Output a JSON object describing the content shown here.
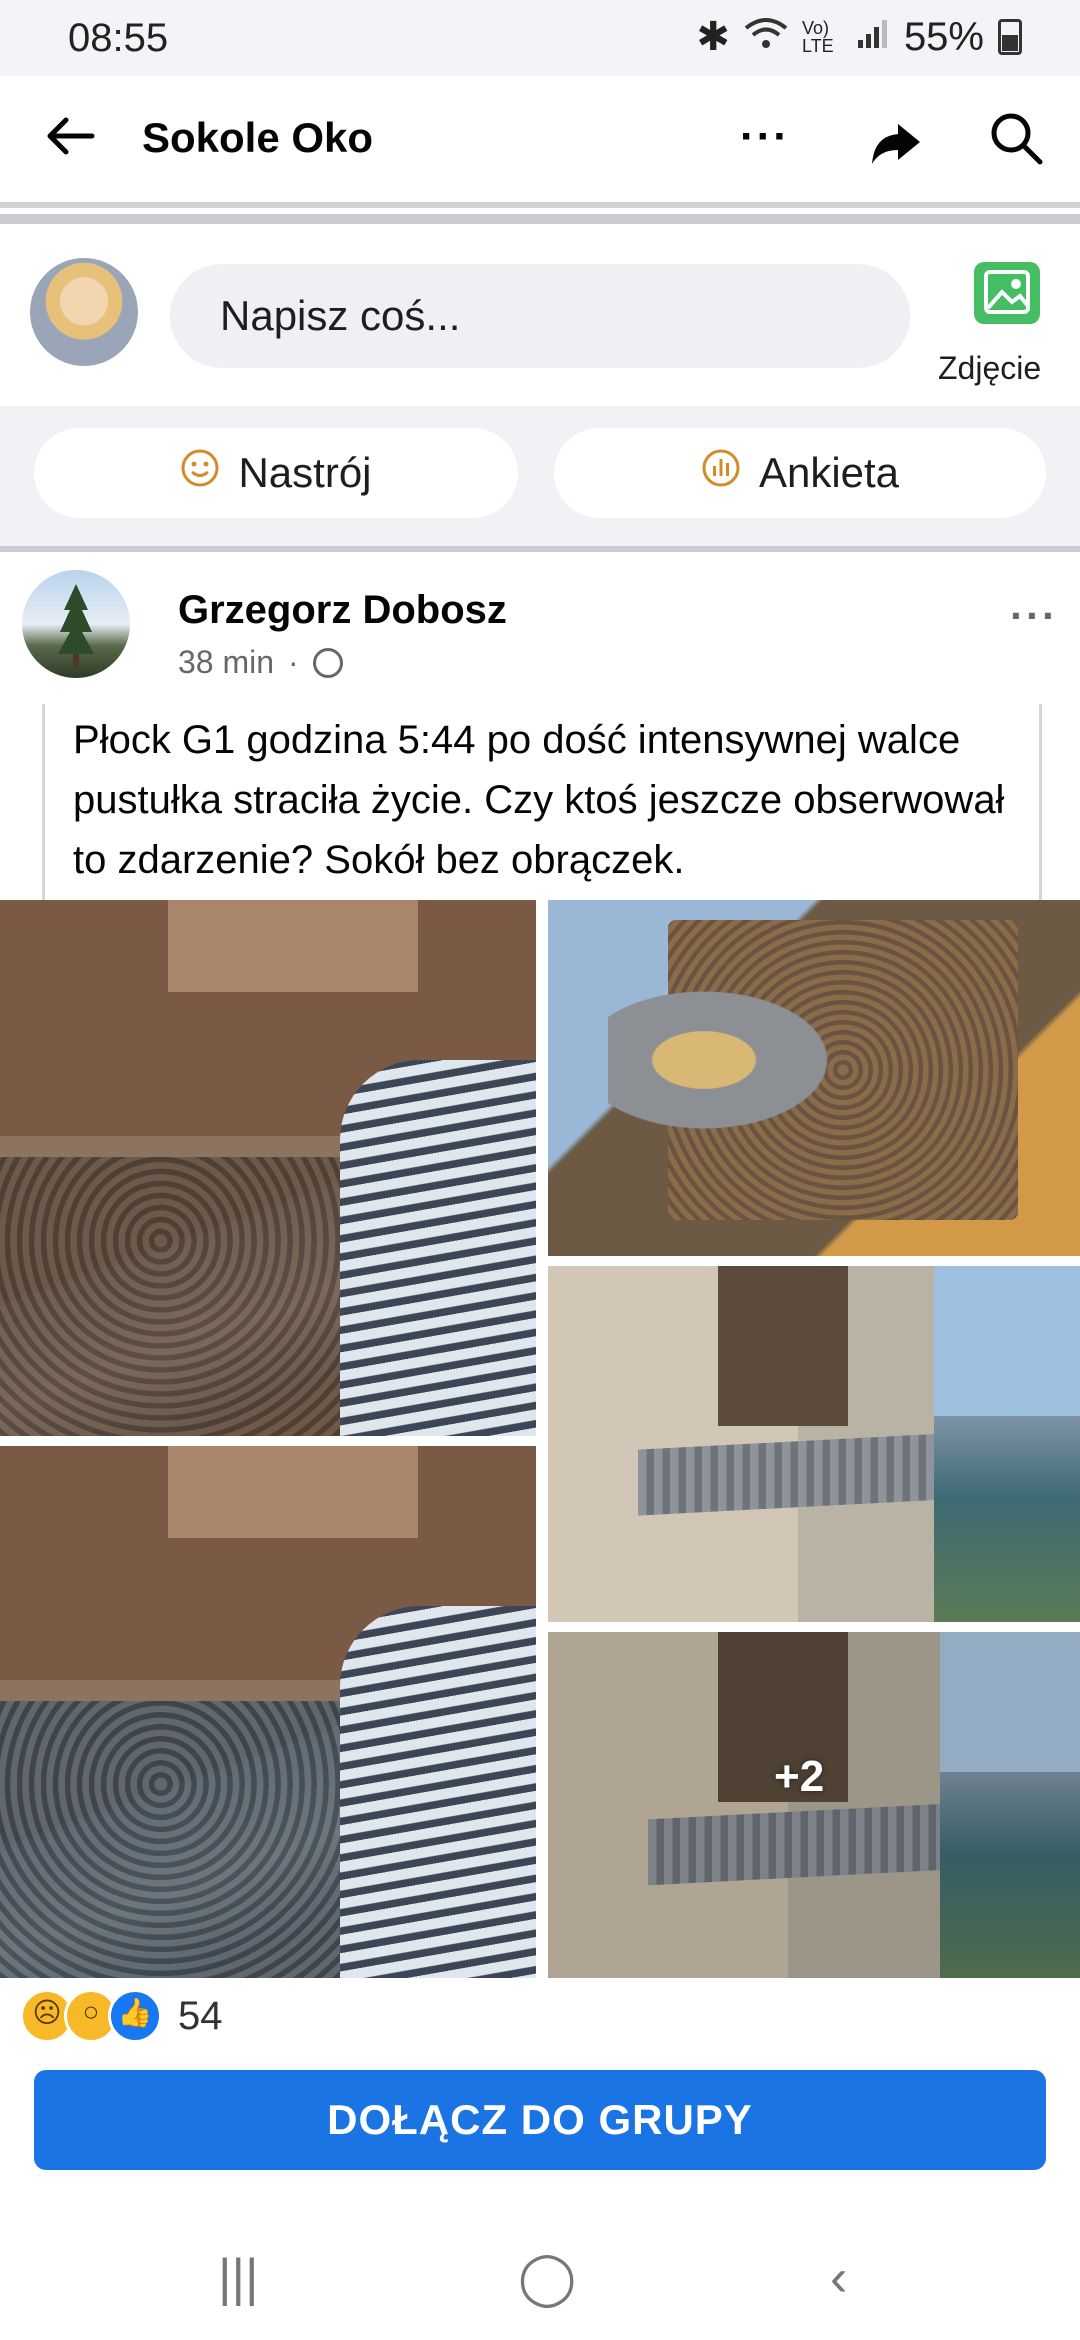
{
  "status_bar": {
    "time": "08:55",
    "signal_text": "Vo) LTE",
    "battery": "55%"
  },
  "header": {
    "title": "Sokole Oko",
    "more_label": "···"
  },
  "composer": {
    "placeholder": "Napisz coś...",
    "photo_label": "Zdjęcie"
  },
  "chips": [
    {
      "label": "Nastrój",
      "icon": "smile-icon"
    },
    {
      "label": "Ankieta",
      "icon": "poll-icon"
    }
  ],
  "post": {
    "author": "Grzegorz Dobosz",
    "time": "38 min",
    "separator": "·",
    "text": "Płock G1  godzina 5:44 po dość intensywnej walce pustułka straciła życie. Czy ktoś jeszcze obserwował to zdarzenie? Sokół bez obrączek.",
    "more_photos": "+2",
    "reaction_count": "54",
    "join_label": "DOŁĄCZ DO GRUPY"
  },
  "nav": {
    "recents": "|||",
    "home": "◯",
    "back": "‹"
  },
  "colors": {
    "primary": "#1b74e4",
    "photo_icon": "#45bd62",
    "chip_icon": "#d38b2a"
  }
}
